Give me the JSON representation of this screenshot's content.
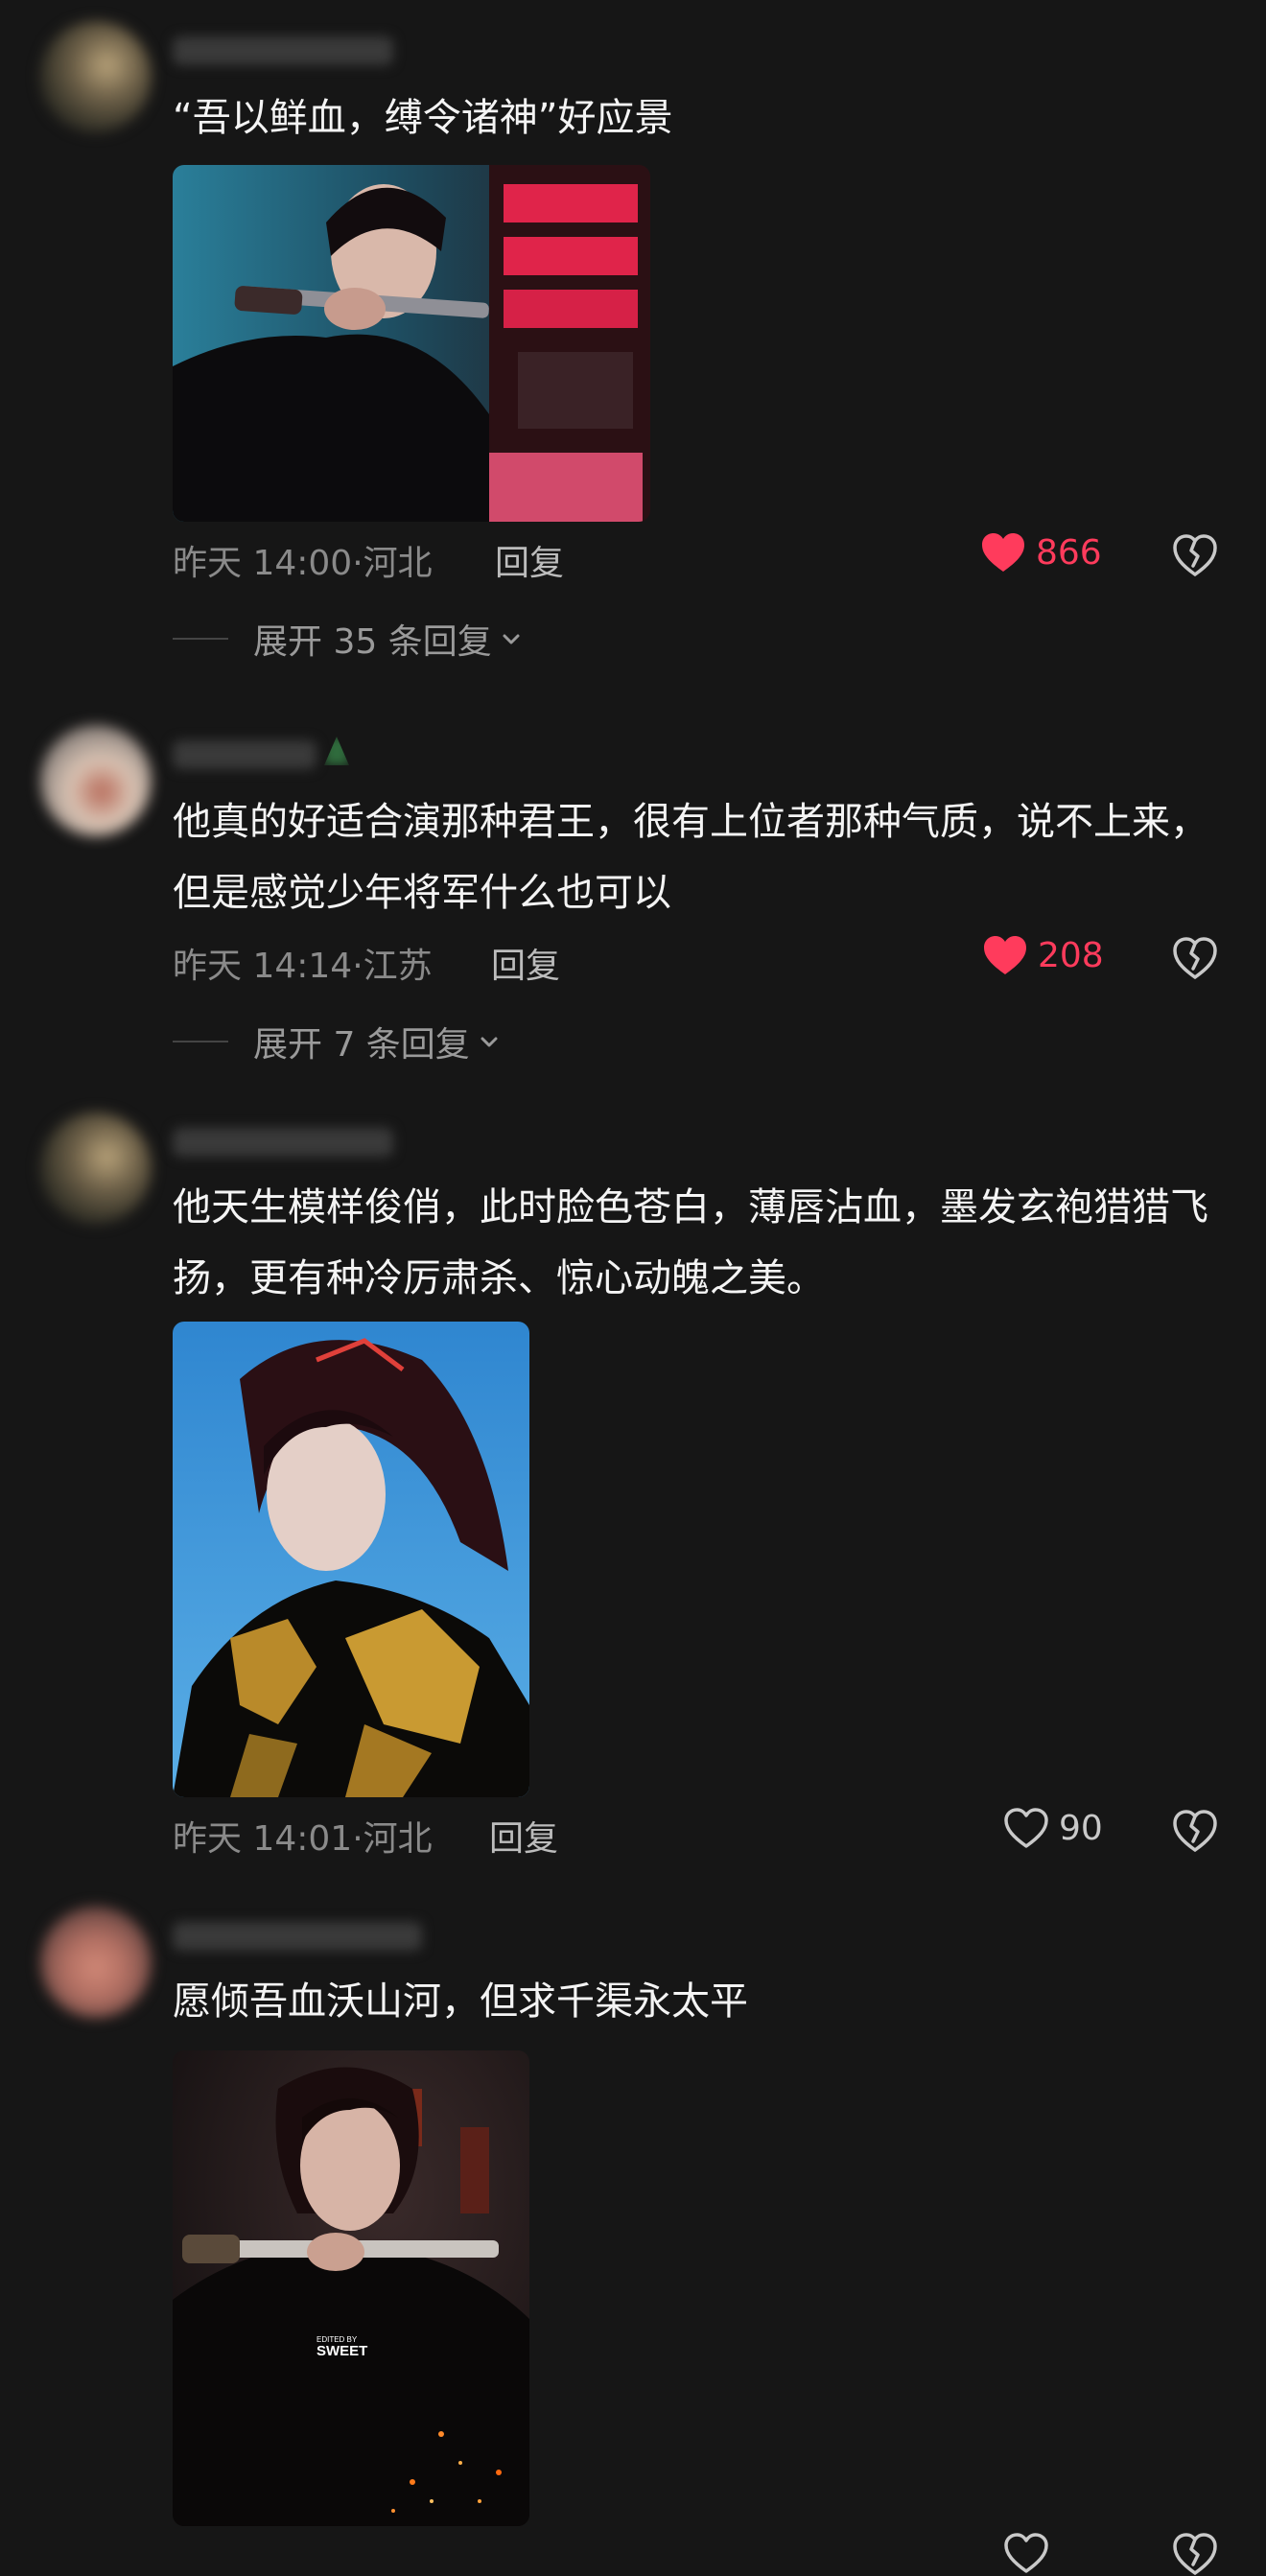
{
  "comments": [
    {
      "text": "“吾以鲜血，缚令诸神”好应景",
      "time": "昨天 14:00",
      "location": "河北",
      "reply_label": "回复",
      "likes": "866",
      "liked": true,
      "expand_label": "展开 35 条回复"
    },
    {
      "text": "他真的好适合演那种君王，很有上位者那种气质，说不上来，但是感觉少年将军什么也可以",
      "time": "昨天 14:14",
      "location": "江苏",
      "reply_label": "回复",
      "likes": "208",
      "liked": true,
      "expand_label": "展开 7 条回复"
    },
    {
      "text": "他天生模样俊俏，此时脸色苍白，薄唇沾血，墨发玄袍猎猎飞扬，更有种冷厉肃杀、惊心动魄之美。",
      "time": "昨天 14:01",
      "location": "河北",
      "reply_label": "回复",
      "likes": "90",
      "liked": false
    },
    {
      "text": "愿倾吾血沃山河，但求千渠永太平",
      "watermark_edited": "EDITED BY",
      "watermark_name": "SWEET"
    }
  ],
  "separator": "·",
  "colors": {
    "background": "#161616",
    "like_active": "#ff3b5c",
    "meta_text": "#8a8a8a"
  },
  "icons": [
    "heart-icon",
    "broken-heart-icon",
    "chevron-down-icon"
  ]
}
